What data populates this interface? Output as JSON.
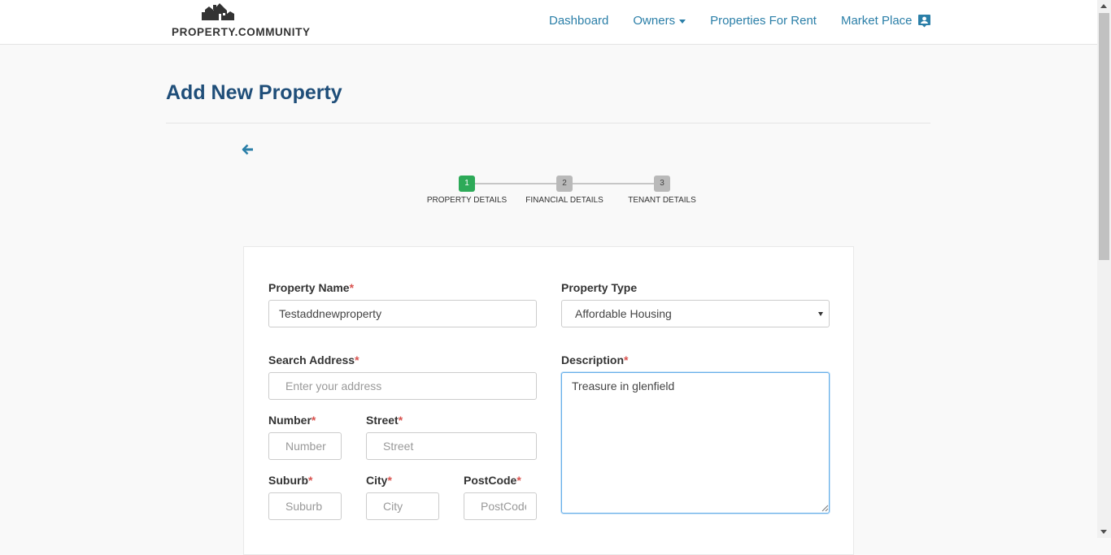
{
  "header": {
    "logo_text": "PROPERTY.COMMUNITY",
    "nav": [
      {
        "label": "Dashboard"
      },
      {
        "label": "Owners",
        "has_dropdown": true
      },
      {
        "label": "Properties For Rent"
      },
      {
        "label": "Market Place"
      }
    ],
    "profile_icon": "account-box-icon"
  },
  "page": {
    "title": "Add New Property",
    "back_icon": "arrow-left-icon"
  },
  "stepper": {
    "steps": [
      {
        "number": "1",
        "label": "PROPERTY DETAILS",
        "active": true
      },
      {
        "number": "2",
        "label": "FINANCIAL DETAILS",
        "active": false
      },
      {
        "number": "3",
        "label": "TENANT DETAILS",
        "active": false
      }
    ],
    "active_color": "#2daa58",
    "inactive_color": "#b9b9b9"
  },
  "form": {
    "required_marker": "*",
    "property_name": {
      "label": "Property Name",
      "value": "Testaddnewproperty"
    },
    "property_type": {
      "label": "Property Type",
      "selected": "Affordable Housing"
    },
    "search_address": {
      "label": "Search Address",
      "placeholder": "Enter your address"
    },
    "description": {
      "label": "Description",
      "value": "Treasure in glenfield"
    },
    "number": {
      "label": "Number",
      "placeholder": "Number"
    },
    "street": {
      "label": "Street",
      "placeholder": "Street"
    },
    "suburb": {
      "label": "Suburb",
      "placeholder": "Suburb"
    },
    "city": {
      "label": "City",
      "placeholder": "City"
    },
    "postcode": {
      "label": "PostCode",
      "placeholder": "PostCode"
    }
  },
  "colors": {
    "link": "#2b7fa8",
    "title": "#1f4e79",
    "required": "#d9534f"
  }
}
